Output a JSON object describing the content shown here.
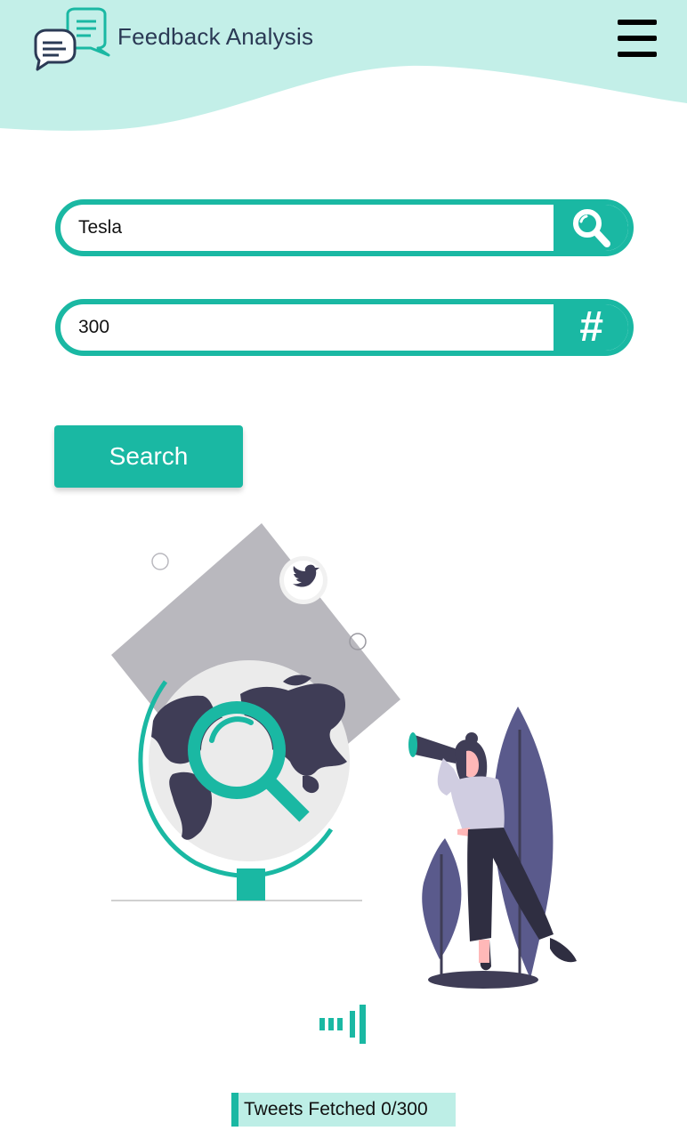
{
  "header": {
    "app_title": "Feedback Analysis",
    "logo_icon": "chat-bubbles-icon",
    "menu_icon": "hamburger-menu-icon"
  },
  "search": {
    "keyword_value": "Tesla",
    "keyword_icon": "magnifier-icon",
    "count_value": "300",
    "count_icon": "hash-icon",
    "count_glyph": "#",
    "button_label": "Search"
  },
  "illustration": {
    "name": "globe-and-telescope-illustration",
    "twitter_icon": "twitter-bird-icon"
  },
  "status": {
    "loader_icon": "loading-bars-icon",
    "tweets_fetched": "Tweets Fetched 0/300",
    "fetched": 0,
    "total": 300
  },
  "colors": {
    "accent": "#1ab8a3",
    "header_bg": "#c3efe8",
    "title": "#2b3a55",
    "illustration_dark": "#3f3d56",
    "leaf": "#5a5a8c",
    "panel_gray": "#b9b8be"
  }
}
